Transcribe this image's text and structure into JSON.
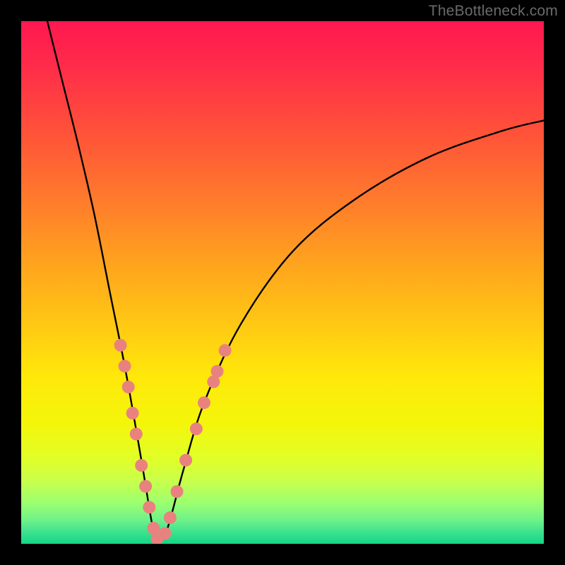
{
  "watermark": {
    "text": "TheBottleneck.com"
  },
  "chart_data": {
    "type": "line",
    "title": "",
    "xlabel": "",
    "ylabel": "",
    "xlim": [
      0,
      100
    ],
    "ylim": [
      0,
      100
    ],
    "grid": false,
    "legend": false,
    "curve": {
      "optimum_x": 26,
      "points": [
        {
          "x": 5,
          "y": 100
        },
        {
          "x": 8,
          "y": 88
        },
        {
          "x": 11,
          "y": 76
        },
        {
          "x": 14,
          "y": 63
        },
        {
          "x": 17,
          "y": 48
        },
        {
          "x": 20,
          "y": 33
        },
        {
          "x": 23,
          "y": 16
        },
        {
          "x": 25,
          "y": 4
        },
        {
          "x": 26,
          "y": 0
        },
        {
          "x": 28,
          "y": 3
        },
        {
          "x": 31,
          "y": 14
        },
        {
          "x": 35,
          "y": 27
        },
        {
          "x": 42,
          "y": 42
        },
        {
          "x": 52,
          "y": 56
        },
        {
          "x": 64,
          "y": 66
        },
        {
          "x": 78,
          "y": 74
        },
        {
          "x": 92,
          "y": 79
        },
        {
          "x": 100,
          "y": 81
        }
      ]
    },
    "markers_left": [
      {
        "x": 19.0,
        "y": 38
      },
      {
        "x": 19.8,
        "y": 34
      },
      {
        "x": 20.5,
        "y": 30
      },
      {
        "x": 21.3,
        "y": 25
      },
      {
        "x": 22.0,
        "y": 21
      },
      {
        "x": 23.0,
        "y": 15
      },
      {
        "x": 23.8,
        "y": 11
      },
      {
        "x": 24.5,
        "y": 7
      },
      {
        "x": 25.3,
        "y": 3
      },
      {
        "x": 26.0,
        "y": 1
      }
    ],
    "markers_right": [
      {
        "x": 27.5,
        "y": 2
      },
      {
        "x": 28.5,
        "y": 5
      },
      {
        "x": 29.8,
        "y": 10
      },
      {
        "x": 31.5,
        "y": 16
      },
      {
        "x": 33.5,
        "y": 22
      },
      {
        "x": 35.0,
        "y": 27
      },
      {
        "x": 36.8,
        "y": 31
      },
      {
        "x": 37.5,
        "y": 33
      },
      {
        "x": 39.0,
        "y": 37
      }
    ],
    "marker_style": {
      "fill": "#e9827f",
      "radius_px": 9
    }
  }
}
